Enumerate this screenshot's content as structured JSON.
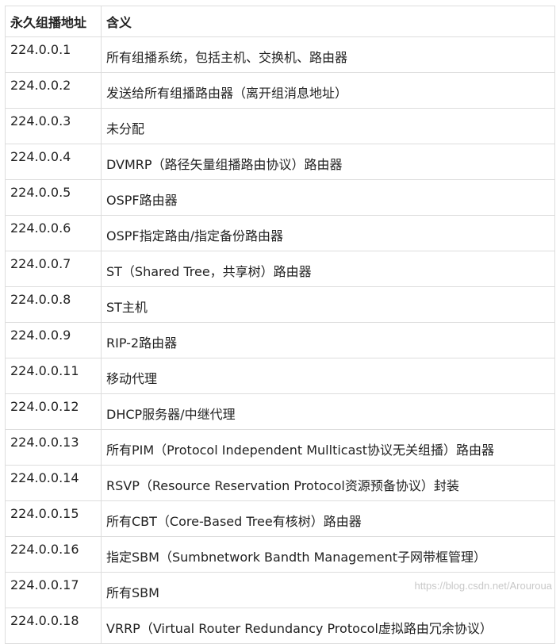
{
  "table": {
    "headers": [
      "永久组播地址",
      "含义"
    ],
    "rows": [
      {
        "address": "224.0.0.1",
        "meaning": "所有组播系统，包括主机、交换机、路由器"
      },
      {
        "address": "224.0.0.2",
        "meaning": "发送给所有组播路由器（离开组消息地址）"
      },
      {
        "address": "224.0.0.3",
        "meaning": "未分配"
      },
      {
        "address": "224.0.0.4",
        "meaning": "DVMRP（路径矢量组播路由协议）路由器"
      },
      {
        "address": "224.0.0.5",
        "meaning": "OSPF路由器"
      },
      {
        "address": "224.0.0.6",
        "meaning": "OSPF指定路由/指定备份路由器"
      },
      {
        "address": "224.0.0.7",
        "meaning": "ST（Shared Tree，共享树）路由器"
      },
      {
        "address": "224.0.0.8",
        "meaning": "ST主机"
      },
      {
        "address": "224.0.0.9",
        "meaning": "RIP-2路由器"
      },
      {
        "address": "224.0.0.11",
        "meaning": "移动代理"
      },
      {
        "address": "224.0.0.12",
        "meaning": "DHCP服务器/中继代理"
      },
      {
        "address": "224.0.0.13",
        "meaning": "所有PIM（Protocol Independent Mullticast协议无关组播）路由器"
      },
      {
        "address": "224.0.0.14",
        "meaning": "RSVP（Resource Reservation Protocol资源预备协议）封装"
      },
      {
        "address": "224.0.0.15",
        "meaning": "所有CBT（Core-Based Tree有核树）路由器"
      },
      {
        "address": "224.0.0.16",
        "meaning": "指定SBM（Sumbnetwork Bandth Management子网带框管理）"
      },
      {
        "address": "224.0.0.17",
        "meaning": "所有SBM"
      },
      {
        "address": "224.0.0.18",
        "meaning": "VRRP（Virtual Router Redundancy Protocol虚拟路由冗余协议）"
      }
    ]
  },
  "watermark": "https://blog.csdn.net/Arouroua"
}
